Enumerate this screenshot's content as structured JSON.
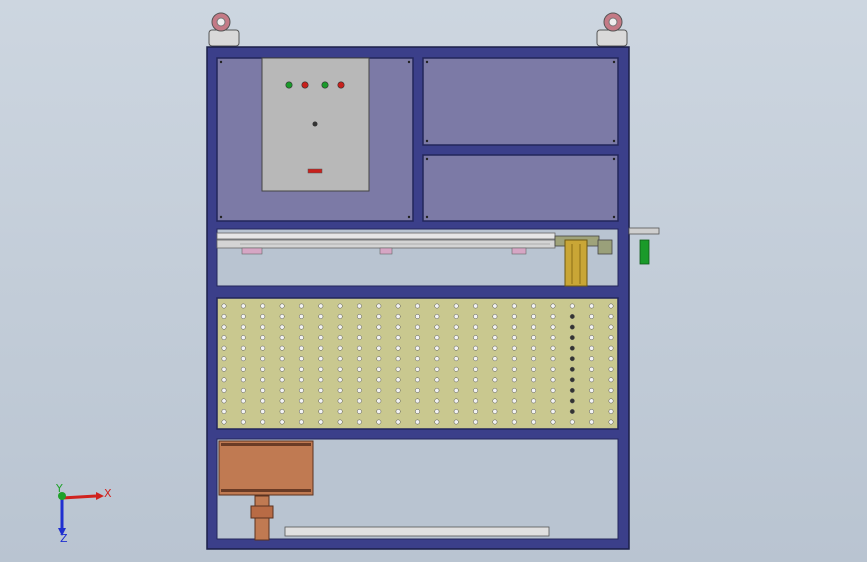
{
  "viewport": {
    "background_top": "#cdd6e0",
    "background_bottom": "#b9c4d1"
  },
  "colors": {
    "frame": "#3b3f8a",
    "frame_dark": "#23275e",
    "panel": "#7c7aa6",
    "panel_border": "#2b2d63",
    "control_box": "#b8b8b8",
    "perforated_plate": "#c9c88f",
    "circuit_board": "#c07a52",
    "brass_rail": "#c9a636",
    "caster": "#d7d7d7",
    "led_green": "#1a9a2a",
    "led_red": "#c8201c"
  },
  "axis_triad": {
    "x_label": "X",
    "y_label": "Y",
    "z_label": "Z",
    "x_color": "#d0221e",
    "y_color": "#1fa12a",
    "z_color": "#1f2fd0"
  },
  "indicators": [
    {
      "name": "indicator-light-1",
      "color": "#1a9a2a"
    },
    {
      "name": "indicator-light-2",
      "color": "#c8201c"
    },
    {
      "name": "indicator-light-3",
      "color": "#1a9a2a"
    },
    {
      "name": "indicator-light-4",
      "color": "#c8201c"
    }
  ],
  "perforated_plate": {
    "columns": 21,
    "rows": 12
  }
}
